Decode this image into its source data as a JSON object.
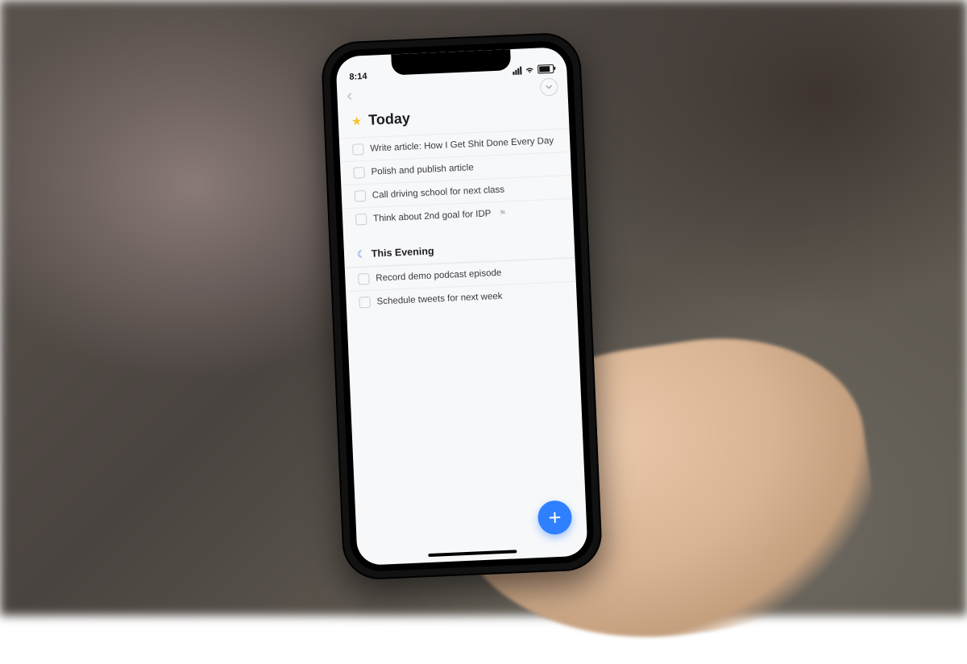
{
  "status": {
    "time": "8:14"
  },
  "header": {
    "title": "Today"
  },
  "today_tasks": [
    {
      "label": "Write article: How I Get Shit Done Every Day"
    },
    {
      "label": "Polish and publish article"
    },
    {
      "label": "Call driving school for next class"
    },
    {
      "label": "Think about 2nd goal for IDP",
      "flagged": true
    }
  ],
  "evening_header": "This Evening",
  "evening_tasks": [
    {
      "label": "Record demo podcast episode"
    },
    {
      "label": "Schedule tweets for next week"
    }
  ]
}
